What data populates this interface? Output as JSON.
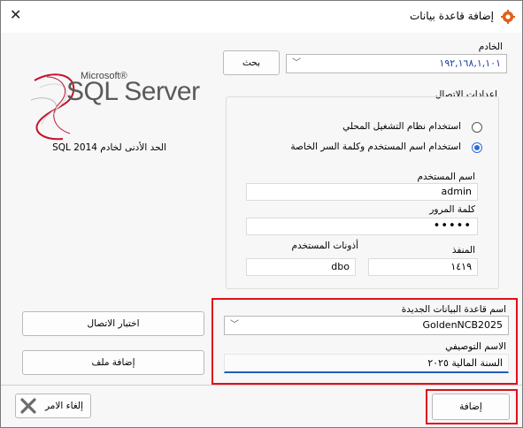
{
  "window": {
    "title": "إضافة قاعدة بيانات"
  },
  "logo": {
    "brand": "Microsoft®",
    "product": "SQL Server"
  },
  "min_version_note": "الحد الأدنى لخادم SQL 2014",
  "server": {
    "label": "الخادم",
    "value": "١٩٢,١٦٨,١,١٠١",
    "search_button": "بحث"
  },
  "connection": {
    "group_label": "اعدادات الاتصال",
    "radio_local": "استخدام نظام التشغيل المحلي",
    "radio_user": "استخدام اسم المستخدم وكلمة السر الخاصة",
    "selected": "user",
    "username_label": "اسم المستخدم",
    "username_value": "admin",
    "password_label": "كلمة المرور",
    "password_value": "•••••",
    "port_label": "المنفذ",
    "port_value": "١٤١٩",
    "schema_label": "أذونات المستخدم",
    "schema_value": "dbo"
  },
  "new_db": {
    "name_label": "اسم قاعدة البيانات الجديدة",
    "name_value": "GoldenNCB2025",
    "desc_label": "الاسم التوصيفي",
    "desc_value": "السنة المالية ٢٠٢٥"
  },
  "buttons": {
    "test_connection": "اختبار الاتصال",
    "add_file": "إضافة ملف",
    "cancel": "إلغاء الامر",
    "add": "إضافة"
  },
  "colors": {
    "highlight": "#e0101a",
    "accent": "#2f6bd6",
    "logo_red": "#c8102e"
  }
}
